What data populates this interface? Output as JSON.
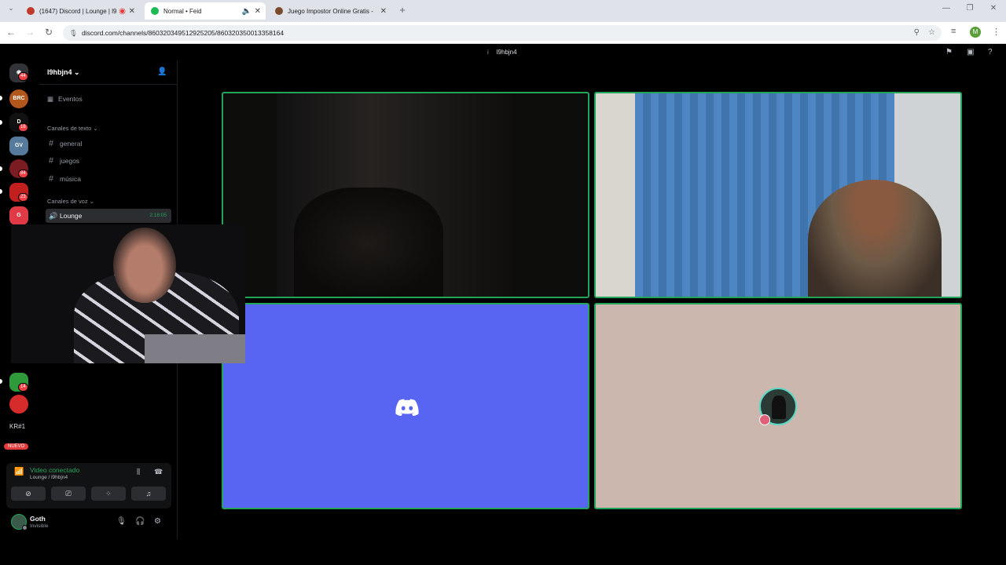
{
  "browser": {
    "tabs": [
      {
        "title": "(1647) Discord | Lounge | l9",
        "favicon_color": "#c0392b"
      },
      {
        "title": "Normal • Feid",
        "favicon_color": "#1db954"
      },
      {
        "title": "Juego Impostor Online Gratis -",
        "favicon_color": "#7a4a2a"
      }
    ],
    "new_tab": "+",
    "url": "discord.com/channels/860320349512925205/860320350013358164",
    "profile_initial": "M"
  },
  "titlebar": {
    "title": "l9hbjn4"
  },
  "servers": {
    "badges": [
      "44",
      "16",
      "84",
      "23",
      "14"
    ],
    "labels": [
      "BRC",
      "D",
      "GV",
      "",
      "",
      "G",
      "",
      ""
    ],
    "text_item": "KR#1",
    "new_badge": "NUEVO"
  },
  "guild": {
    "name": "l9hbjn4",
    "events": "Eventos",
    "text_category": "Canales de texto",
    "text_channels": [
      "general",
      "juegos",
      "música"
    ],
    "voice_category": "Canales de voz",
    "voice_channel": "Lounge",
    "voice_timer": "2:18:05"
  },
  "voice_panel": {
    "title": "Video conectado",
    "subtitle": "Lounge / l9hbjn4"
  },
  "user": {
    "name": "Goth",
    "status": "Invisible"
  },
  "colors": {
    "accent_green": "#23a559",
    "blurple": "#5865f2",
    "tile_pink": "#ccb7ae"
  }
}
